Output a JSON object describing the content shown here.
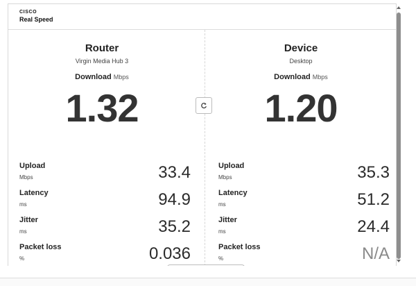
{
  "header": {
    "brand_logo": "CISCO",
    "brand_name": "Real Speed"
  },
  "router": {
    "title": "Router",
    "subtitle": "Virgin Media Hub 3",
    "download_label": "Download",
    "download_unit": "Mbps",
    "download_value": "1.32",
    "metrics": [
      {
        "label": "Upload",
        "unit": "Mbps",
        "value": "33.4"
      },
      {
        "label": "Latency",
        "unit": "ms",
        "value": "94.9"
      },
      {
        "label": "Jitter",
        "unit": "ms",
        "value": "35.2"
      },
      {
        "label": "Packet loss",
        "unit": "%",
        "value": "0.036"
      }
    ]
  },
  "device": {
    "title": "Device",
    "subtitle": "Desktop",
    "download_label": "Download",
    "download_unit": "Mbps",
    "download_value": "1.20",
    "metrics": [
      {
        "label": "Upload",
        "unit": "Mbps",
        "value": "35.3"
      },
      {
        "label": "Latency",
        "unit": "ms",
        "value": "51.2"
      },
      {
        "label": "Jitter",
        "unit": "ms",
        "value": "24.4"
      },
      {
        "label": "Packet loss",
        "unit": "%",
        "value": "N/A"
      }
    ]
  },
  "refresh_icon": "refresh-icon"
}
